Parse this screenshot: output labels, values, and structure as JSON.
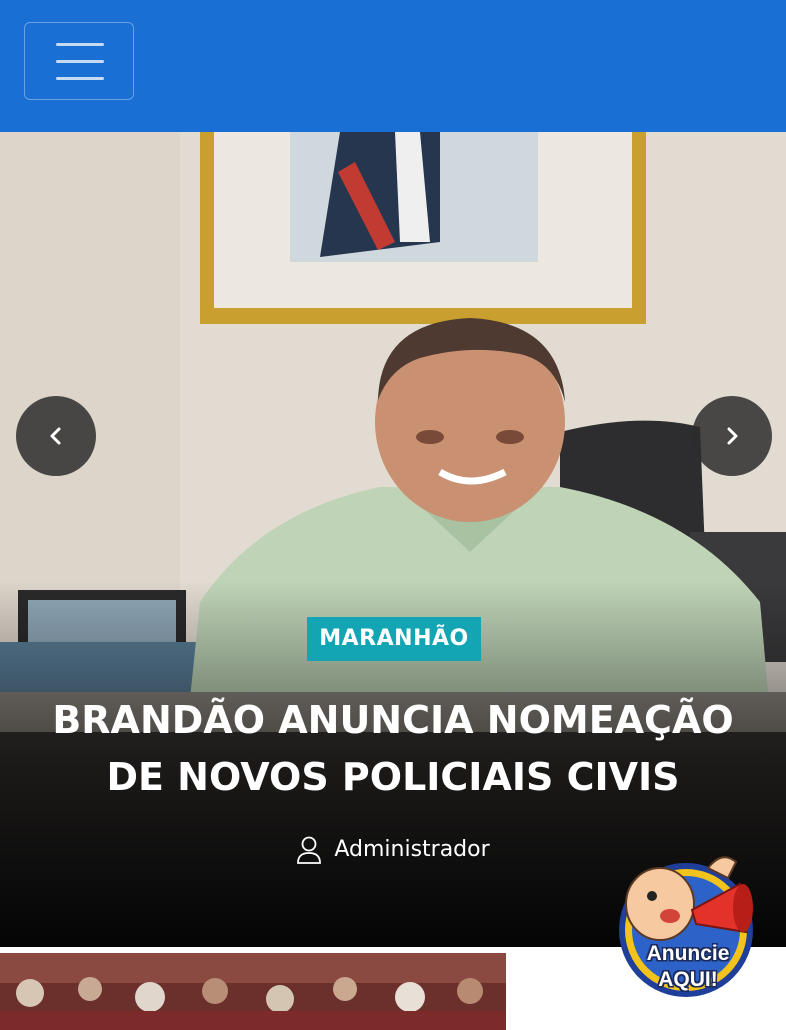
{
  "navbar": {
    "background_color": "#1a6fd4",
    "menu_icon": "hamburger-icon"
  },
  "hero": {
    "category": "MARANHÃO",
    "category_color": "#14a5b5",
    "headline": "BRANDÃO ANUNCIA NOMEAÇÃO DE NOVOS POLICIAIS CIVIS",
    "author": "Administrador",
    "author_icon": "user-icon",
    "prev_icon": "chevron-left-icon",
    "next_icon": "chevron-right-icon"
  },
  "ad": {
    "line1": "Anuncie",
    "line2": "AQUI!"
  }
}
